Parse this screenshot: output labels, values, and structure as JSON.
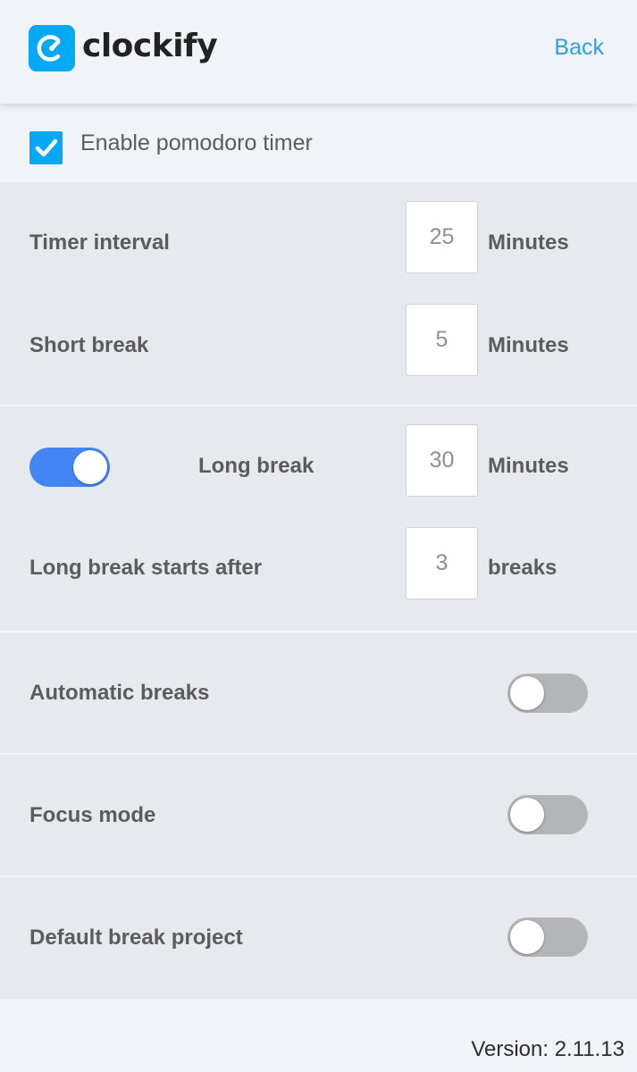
{
  "app": {
    "logo_text": "clockify",
    "back_label": "Back",
    "brand_color": "#03a9f4",
    "link_color": "#2d9fe0",
    "toggle_on_color": "#4285f4",
    "toggle_off_color": "#b3b5b8"
  },
  "pomodoro": {
    "enable_label": "Enable pomodoro timer",
    "enabled": true
  },
  "timer_interval": {
    "label": "Timer interval",
    "value": "25",
    "unit": "Minutes"
  },
  "short_break": {
    "label": "Short break",
    "value": "5",
    "unit": "Minutes"
  },
  "long_break": {
    "label": "Long break",
    "value": "30",
    "unit": "Minutes",
    "enabled": true
  },
  "long_break_after": {
    "label": "Long break starts after",
    "value": "3",
    "unit": "breaks"
  },
  "automatic_breaks": {
    "label": "Automatic breaks",
    "enabled": false
  },
  "focus_mode": {
    "label": "Focus mode",
    "enabled": false
  },
  "default_break_project": {
    "label": "Default break project",
    "enabled": false
  },
  "footer": {
    "version": "Version: 2.11.13"
  }
}
